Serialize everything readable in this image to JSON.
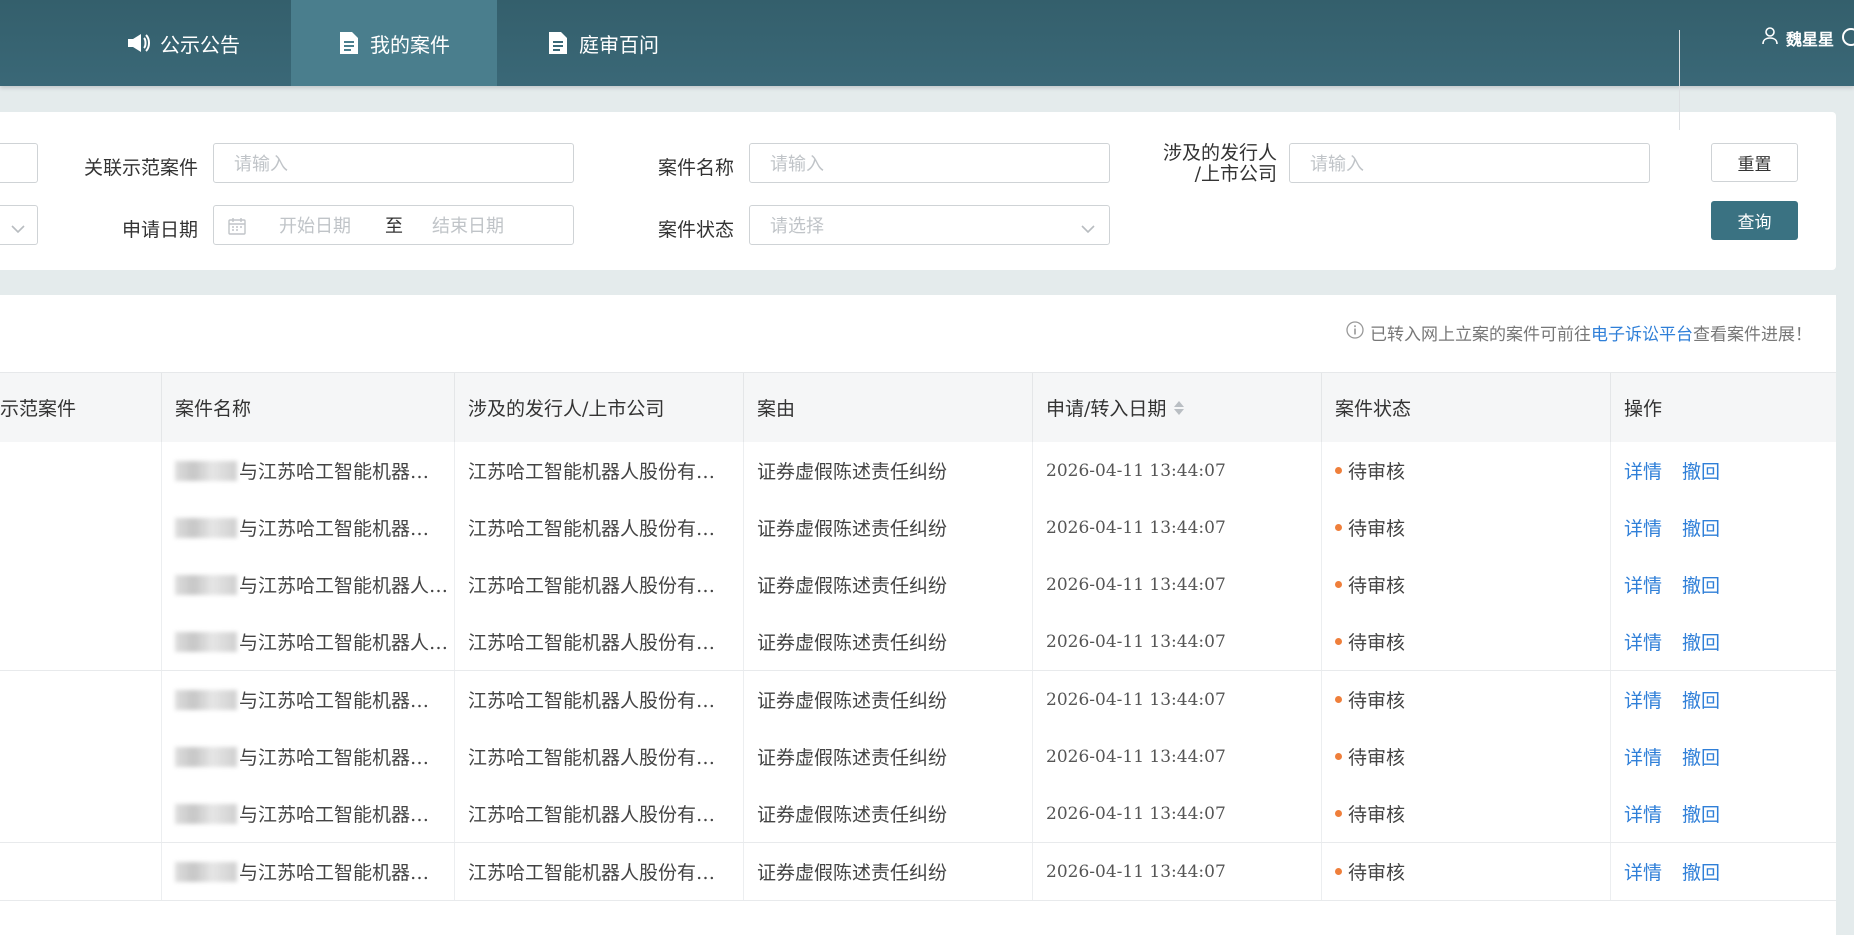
{
  "nav": {
    "tabs": [
      {
        "label": "公示公告",
        "icon": "megaphone-icon"
      },
      {
        "label": "我的案件",
        "icon": "document-icon",
        "active": true
      },
      {
        "label": "庭审百问",
        "icon": "document-icon"
      }
    ],
    "user_name": "魏星星"
  },
  "filters": {
    "related_case": {
      "label": "关联示范案件",
      "placeholder": "请输入"
    },
    "case_name": {
      "label": "案件名称",
      "placeholder": "请输入"
    },
    "issuer": {
      "label_line1": "涉及的发行人",
      "label_line2": "/上市公司",
      "placeholder": "请输入"
    },
    "apply_date": {
      "label": "申请日期",
      "start_placeholder": "开始日期",
      "separator": "至",
      "end_placeholder": "结束日期"
    },
    "case_status": {
      "label": "案件状态",
      "placeholder": "请选择"
    },
    "reset_label": "重置",
    "query_label": "查询"
  },
  "notice": {
    "prefix": "已转入网上立案的案件可前往",
    "link": "电子诉讼平台",
    "suffix": "查看案件进展！"
  },
  "table": {
    "columns": [
      "示范案件",
      "案件名称",
      "涉及的发行人/上市公司",
      "案由",
      "申请/转入日期",
      "案件状态",
      "操作"
    ],
    "rows": [
      {
        "name": "与江苏哈工智能机器…",
        "issuer": "江苏哈工智能机器人股份有…",
        "cause": "证券虚假陈述责任纠纷",
        "date": "2026-04-11 13:44:07",
        "status": "待审核",
        "action1": "详情",
        "action2": "撤回"
      },
      {
        "name": "与江苏哈工智能机器…",
        "issuer": "江苏哈工智能机器人股份有…",
        "cause": "证券虚假陈述责任纠纷",
        "date": "2026-04-11 13:44:07",
        "status": "待审核",
        "action1": "详情",
        "action2": "撤回"
      },
      {
        "name": "与江苏哈工智能机器人…",
        "issuer": "江苏哈工智能机器人股份有…",
        "cause": "证券虚假陈述责任纠纷",
        "date": "2026-04-11 13:44:07",
        "status": "待审核",
        "action1": "详情",
        "action2": "撤回"
      },
      {
        "name": "与江苏哈工智能机器人…",
        "issuer": "江苏哈工智能机器人股份有…",
        "cause": "证券虚假陈述责任纠纷",
        "date": "2026-04-11 13:44:07",
        "status": "待审核",
        "action1": "详情",
        "action2": "撤回"
      },
      {
        "name": "与江苏哈工智能机器…",
        "issuer": "江苏哈工智能机器人股份有…",
        "cause": "证券虚假陈述责任纠纷",
        "date": "2026-04-11 13:44:07",
        "status": "待审核",
        "action1": "详情",
        "action2": "撤回"
      },
      {
        "name": "与江苏哈工智能机器…",
        "issuer": "江苏哈工智能机器人股份有…",
        "cause": "证券虚假陈述责任纠纷",
        "date": "2026-04-11 13:44:07",
        "status": "待审核",
        "action1": "详情",
        "action2": "撤回"
      },
      {
        "name": "与江苏哈工智能机器…",
        "issuer": "江苏哈工智能机器人股份有…",
        "cause": "证券虚假陈述责任纠纷",
        "date": "2026-04-11 13:44:07",
        "status": "待审核",
        "action1": "详情",
        "action2": "撤回"
      },
      {
        "name": "与江苏哈工智能机器…",
        "issuer": "江苏哈工智能机器人股份有…",
        "cause": "证券虚假陈述责任纠纷",
        "date": "2026-04-11 13:44:07",
        "status": "待审核",
        "action1": "详情",
        "action2": "撤回"
      }
    ]
  },
  "colors": {
    "nav_bg": "#3a6877",
    "nav_active": "#4a7e8d",
    "primary_button": "#3a7282",
    "link": "#2f7fd8",
    "status_dot": "#ef7f3b"
  }
}
